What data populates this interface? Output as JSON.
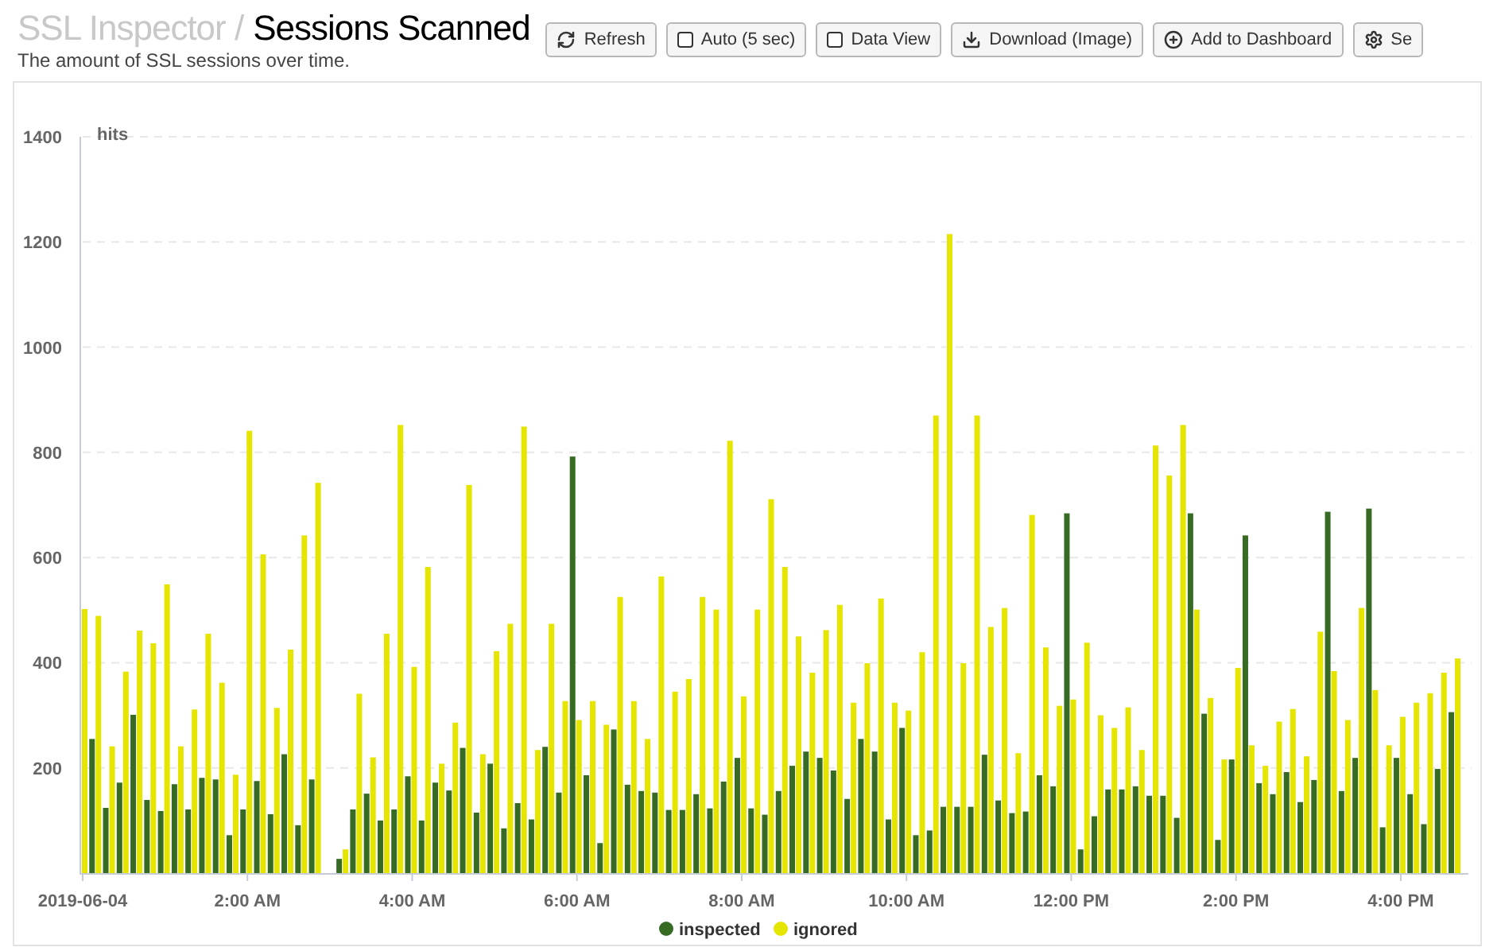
{
  "header": {
    "section": "SSL Inspector /",
    "title": "Sessions Scanned",
    "subtitle": "The amount of SSL sessions over time."
  },
  "toolbar": [
    {
      "kind": "refresh",
      "label": "Refresh"
    },
    {
      "kind": "checkbox",
      "label": "Auto (5 sec)",
      "checked": false
    },
    {
      "kind": "checkbox",
      "label": "Data View",
      "checked": false
    },
    {
      "kind": "download",
      "label": "Download (Image)"
    },
    {
      "kind": "add",
      "label": "Add to Dashboard"
    },
    {
      "kind": "settings",
      "label": "Se"
    }
  ],
  "chart": {
    "chart_data": {
      "type": "bar",
      "grid": true,
      "legend": true,
      "ylabel": "hits",
      "xlim": [
        0,
        1000
      ],
      "ylim": [
        0,
        1400
      ],
      "yticks": [
        200,
        400,
        600,
        800,
        1000,
        1200,
        1400
      ],
      "xticks": [
        {
          "value": 0,
          "label": "2019-06-04"
        },
        {
          "value": 120,
          "label": "2:00 AM"
        },
        {
          "value": 240,
          "label": "4:00 AM"
        },
        {
          "value": 360,
          "label": "6:00 AM"
        },
        {
          "value": 480,
          "label": "8:00 AM"
        },
        {
          "value": 600,
          "label": "10:00 AM"
        },
        {
          "value": 720,
          "label": "12:00 PM"
        },
        {
          "value": 840,
          "label": "2:00 PM"
        },
        {
          "value": 960,
          "label": "4:00 PM"
        }
      ],
      "x": [
        0,
        10,
        20,
        30,
        40,
        50,
        60,
        70,
        80,
        90,
        100,
        110,
        120,
        130,
        140,
        150,
        160,
        170,
        180,
        190,
        200,
        210,
        220,
        230,
        240,
        250,
        260,
        270,
        280,
        290,
        300,
        310,
        320,
        330,
        340,
        350,
        360,
        370,
        380,
        390,
        400,
        410,
        420,
        430,
        440,
        450,
        460,
        470,
        480,
        490,
        500,
        510,
        520,
        530,
        540,
        550,
        560,
        570,
        580,
        590,
        600,
        610,
        620,
        630,
        640,
        650,
        660,
        670,
        680,
        690,
        700,
        710,
        720,
        730,
        740,
        750,
        760,
        770,
        780,
        790,
        800,
        810,
        820,
        830,
        840,
        850,
        860,
        870,
        880,
        890,
        900,
        910,
        920,
        930,
        940,
        950,
        960,
        970,
        980,
        990,
        1000
      ],
      "series": [
        {
          "name": "inspected",
          "color": "#376b24",
          "values": [
            null,
            255,
            124,
            172,
            301,
            139,
            118,
            169,
            121,
            181,
            178,
            72,
            121,
            175,
            112,
            226,
            91,
            178,
            null,
            27,
            121,
            151,
            100,
            121,
            184,
            100,
            172,
            157,
            238,
            115,
            208,
            85,
            133,
            102,
            240,
            153,
            792,
            186,
            57,
            273,
            168,
            156,
            153,
            120,
            120,
            150,
            123,
            174,
            219,
            123,
            111,
            156,
            204,
            231,
            219,
            195,
            141,
            255,
            231,
            102,
            276,
            72,
            81,
            126,
            126,
            126,
            225,
            138,
            114,
            117,
            186,
            165,
            684,
            45,
            108,
            159,
            159,
            165,
            147,
            147,
            105,
            684,
            303,
            63,
            216,
            642,
            171,
            150,
            192,
            135,
            177,
            687,
            156,
            219,
            693,
            87,
            219,
            150,
            93,
            198,
            306
          ]
        },
        {
          "name": "ignored",
          "color": "#e5e500",
          "values": [
            502,
            489,
            241,
            383,
            461,
            437,
            549,
            241,
            311,
            455,
            362,
            187,
            841,
            606,
            314,
            425,
            642,
            742,
            null,
            45,
            341,
            220,
            455,
            852,
            392,
            582,
            208,
            286,
            738,
            226,
            422,
            474,
            849,
            234,
            474,
            327,
            291,
            327,
            282,
            525,
            327,
            255,
            564,
            345,
            369,
            525,
            501,
            822,
            336,
            501,
            711,
            582,
            450,
            381,
            462,
            510,
            324,
            399,
            522,
            324,
            309,
            420,
            870,
            1215,
            399,
            870,
            468,
            504,
            228,
            681,
            429,
            318,
            330,
            438,
            300,
            276,
            315,
            234,
            813,
            756,
            852,
            501,
            333,
            216,
            390,
            243,
            204,
            288,
            312,
            222,
            459,
            384,
            291,
            504,
            348,
            243,
            297,
            324,
            342,
            381,
            408
          ]
        }
      ]
    }
  }
}
